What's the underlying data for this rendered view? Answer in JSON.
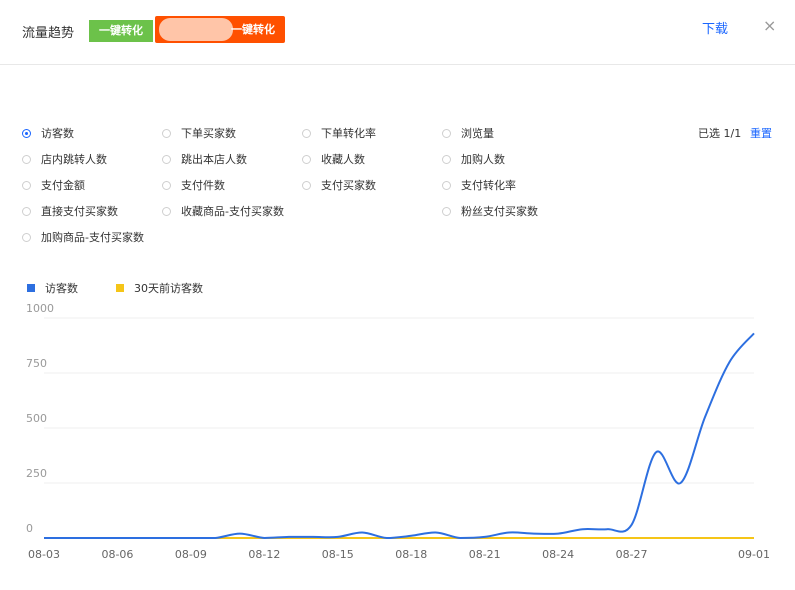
{
  "header": {
    "title": "流量趋势",
    "tag_green": "一键转化",
    "tag_orange": "一键转化",
    "download": "下载",
    "close": "×"
  },
  "metrics": {
    "selected_info": "已选 1/1",
    "reset": "重置",
    "options": [
      {
        "label": "访客数",
        "selected": true
      },
      {
        "label": "下单买家数",
        "selected": false
      },
      {
        "label": "下单转化率",
        "selected": false
      },
      {
        "label": "浏览量",
        "selected": false
      },
      {
        "label": "店内跳转人数",
        "selected": false
      },
      {
        "label": "跳出本店人数",
        "selected": false
      },
      {
        "label": "收藏人数",
        "selected": false
      },
      {
        "label": "加购人数",
        "selected": false
      },
      {
        "label": "支付金额",
        "selected": false
      },
      {
        "label": "支付件数",
        "selected": false
      },
      {
        "label": "支付买家数",
        "selected": false
      },
      {
        "label": "支付转化率",
        "selected": false
      },
      {
        "label": "直接支付买家数",
        "selected": false
      },
      {
        "label": "收藏商品-支付买家数",
        "selected": false
      },
      {
        "label": "粉丝支付买家数",
        "selected": false
      },
      {
        "label": "加购商品-支付买家数",
        "selected": false
      }
    ]
  },
  "colors": {
    "accent": "#1a66ff",
    "series1": "#2d6fe0",
    "series2": "#f5c518",
    "green": "#6cc24a",
    "orange": "#ff5000"
  },
  "chart_data": {
    "type": "line",
    "x": [
      "08-03",
      "08-04",
      "08-05",
      "08-06",
      "08-07",
      "08-08",
      "08-09",
      "08-10",
      "08-11",
      "08-12",
      "08-13",
      "08-14",
      "08-15",
      "08-16",
      "08-17",
      "08-18",
      "08-19",
      "08-20",
      "08-21",
      "08-22",
      "08-23",
      "08-24",
      "08-25",
      "08-26",
      "08-27",
      "08-28",
      "08-29",
      "08-30",
      "08-31",
      "09-01"
    ],
    "tick_labels": [
      "08-03",
      "08-06",
      "08-09",
      "08-12",
      "08-15",
      "08-18",
      "08-21",
      "08-24",
      "08-27",
      "09-01"
    ],
    "series": [
      {
        "name": "访客数",
        "color": "#2d6fe0",
        "values": [
          0,
          0,
          0,
          0,
          0,
          0,
          0,
          0,
          20,
          0,
          5,
          5,
          5,
          25,
          0,
          10,
          25,
          0,
          5,
          25,
          20,
          20,
          40,
          40,
          60,
          390,
          250,
          550,
          800,
          930
        ]
      },
      {
        "name": "30天前访客数",
        "color": "#f5c518",
        "values": [
          0,
          0,
          0,
          0,
          0,
          0,
          0,
          0,
          0,
          0,
          0,
          0,
          0,
          0,
          0,
          0,
          0,
          0,
          0,
          0,
          0,
          0,
          0,
          0,
          0,
          0,
          0,
          0,
          0,
          0
        ]
      }
    ],
    "yticks": [
      0,
      250,
      500,
      750,
      1000
    ],
    "ylim": [
      0,
      1000
    ],
    "grid": true,
    "legend_position": "top-left"
  }
}
